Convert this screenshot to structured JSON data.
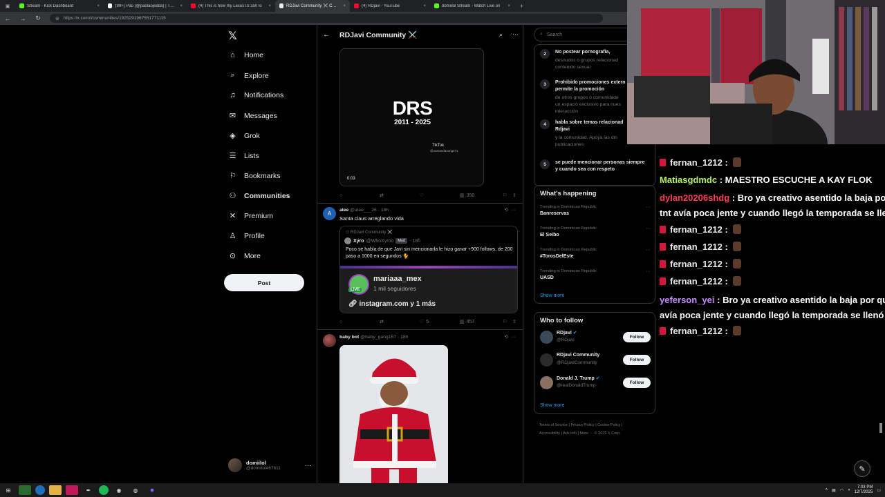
{
  "browser": {
    "tabs": [
      {
        "title": "Stream - Kick Dashboard",
        "color": "#53fc18"
      },
      {
        "title": "(99+) Pao (@paolaojedda) | TikTok",
        "color": "#ffffff"
      },
      {
        "title": "(4) This is how my Lexus IS 350 lo",
        "color": "#ff0033"
      },
      {
        "title": "RDJavi Community ⚔️ Commun",
        "color": "#e7e9ea",
        "active": true
      },
      {
        "title": "(4) RDjavi - YouTube",
        "color": "#ff0033"
      },
      {
        "title": "domiilol Stream - Watch Live on",
        "color": "#53fc18"
      }
    ],
    "url": "https://x.com/i/communities/1925291967551771115"
  },
  "nav": {
    "items": [
      {
        "label": "Home",
        "icon": "home-icon"
      },
      {
        "label": "Explore",
        "icon": "search-icon"
      },
      {
        "label": "Notifications",
        "icon": "bell-icon"
      },
      {
        "label": "Messages",
        "icon": "mail-icon"
      },
      {
        "label": "Grok",
        "icon": "grok-icon"
      },
      {
        "label": "Lists",
        "icon": "list-icon"
      },
      {
        "label": "Bookmarks",
        "icon": "bookmark-icon"
      },
      {
        "label": "Communities",
        "icon": "people-icon",
        "active": true
      },
      {
        "label": "Premium",
        "icon": "x-icon"
      },
      {
        "label": "Profile",
        "icon": "person-icon"
      },
      {
        "label": "More",
        "icon": "more-circle-icon"
      }
    ],
    "post_label": "Post",
    "user": {
      "name": "domiilol",
      "handle": "@domiilol467611"
    }
  },
  "feed": {
    "title": "RDJavi Community ⚔️",
    "video": {
      "big": "DRS",
      "years": "2011 - 2025",
      "tiktok": "TikTok",
      "tiktok_handle": "@oamandasongs71",
      "time": "0:03"
    },
    "post1_actions": {
      "views": "350"
    },
    "post2": {
      "name": "alee",
      "handle": "@alee___26 · 18h",
      "avatar_letter": "A",
      "text": "Santa claus arreglando vida",
      "quote": {
        "community": "RDJavi Community ⚔️",
        "name": "Xyro",
        "handle": "@WhoXyroo",
        "badge": "Mod",
        "time": "18h",
        "text": "Poco se habla de que Javi sin mencionarla le hizo ganar +900 follows, de 200 paso a 1000 en segundos 🐈",
        "ig_name": "mariaaa_mex",
        "ig_sub": "1 mil seguidores",
        "live": "LIVE",
        "ig_link": "instagram.com y 1 más"
      },
      "likes": "5",
      "views": "457"
    },
    "post3": {
      "name": "baby bot",
      "handle": "@baby_gang157 · 18h"
    }
  },
  "right": {
    "search_placeholder": "Search",
    "rules": [
      {
        "num": "2",
        "title": "No postear pornografía,",
        "desc": [
          "desnudos o grupos relacionad",
          "contenido sexual"
        ]
      },
      {
        "num": "3",
        "title": "Prohibido promociones extern\npermite la promoción",
        "desc": [
          "de otros grupos o comunidade",
          "un espacio exclusivo para nues",
          "interacción"
        ]
      },
      {
        "num": "4",
        "title": "habla sobre temas relacionad\nRdjavi",
        "desc": [
          "y la comunidad. Apoya las din",
          "publicaciones"
        ]
      },
      {
        "num": "5",
        "title": "se puede mencionar personas siempre\ny cuando sea con respeto",
        "desc": []
      }
    ],
    "happening_title": "What's happening",
    "trends": [
      {
        "context": "Trending in Dominican Republic",
        "name": "Banreservas"
      },
      {
        "context": "Trending in Dominican Republic",
        "name": "El Seibo"
      },
      {
        "context": "Trending in Dominican Republic",
        "name": "#TorosDelEste"
      },
      {
        "context": "Trending in Dominican Republic",
        "name": "UASD"
      }
    ],
    "show_more": "Show more",
    "wtf_title": "Who to follow",
    "follow": [
      {
        "name": "RDjavi",
        "handle": "@RDjavi",
        "btn": "Follow"
      },
      {
        "name": "RDjavi Community",
        "handle": "@RDjaviCommunity",
        "btn": "Follow"
      },
      {
        "name": "Donald J. Trump",
        "handle": "@realDonaldTrump",
        "btn": "Follow"
      }
    ],
    "footer_line1": "Terms of Service  |  Privacy Policy  |  Cookie Policy  |",
    "footer_line2": "Accessibility  |  Ads info  |  More ···  © 2025 X Corp."
  },
  "chat": {
    "lines": [
      {
        "user": "fernan_1212",
        "color": "#e7e9ea",
        "msg": "",
        "badge": true,
        "emote": true
      },
      {
        "user": "Matiasgdmdc",
        "color": "#b6f25a",
        "msg": "MAESTRO ESCUCHE A KAY FLOK",
        "badge": false,
        "emote": false
      },
      {
        "user": "dylan20206shdg",
        "color": "#ff3d57",
        "msg": "Bro ya creativo asentido la baja po",
        "badge": false,
        "emote": false
      },
      {
        "user": "",
        "color": "#ffffff",
        "msg": "tnt avía poca jente y cuando llegó la temporada se llen",
        "badge": false,
        "emote": false
      },
      {
        "user": "fernan_1212",
        "color": "#e7e9ea",
        "msg": "",
        "badge": true,
        "emote": true
      },
      {
        "user": "fernan_1212",
        "color": "#e7e9ea",
        "msg": "",
        "badge": true,
        "emote": true
      },
      {
        "user": "fernan_1212",
        "color": "#e7e9ea",
        "msg": "",
        "badge": true,
        "emote": true
      },
      {
        "user": "fernan_1212",
        "color": "#e7e9ea",
        "msg": "",
        "badge": true,
        "emote": true
      },
      {
        "user": "yeferson_yei",
        "color": "#c58cff",
        "msg": "Bro ya creativo asentido la baja por qu",
        "badge": false,
        "emote": false
      },
      {
        "user": "",
        "color": "#ffffff",
        "msg": "avía poca jente y cuando llegó la temporada se llenó d",
        "badge": false,
        "emote": false
      },
      {
        "user": "fernan_1212",
        "color": "#e7e9ea",
        "msg": "",
        "badge": true,
        "emote": true
      }
    ]
  },
  "taskbar": {
    "time": "7:03 PM",
    "date": "12/7/2025"
  }
}
